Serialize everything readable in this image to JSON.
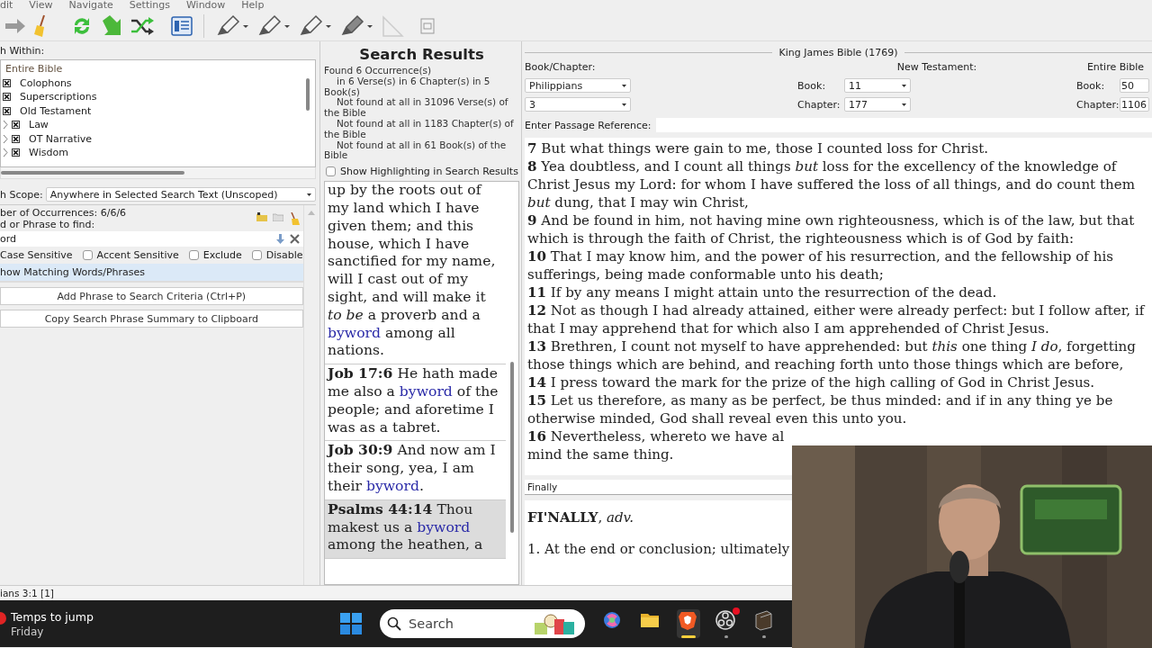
{
  "menu_bar": {
    "items": [
      "dit",
      "View",
      "Navigate",
      "Settings",
      "Window",
      "Help"
    ]
  },
  "search_within": {
    "label": "h Within:",
    "tree": [
      {
        "label": "Entire Bible",
        "children": [
          {
            "label": "Colophons",
            "checked": true
          },
          {
            "label": "Superscriptions",
            "checked": true
          },
          {
            "label": "Old Testament",
            "checked": true,
            "children": [
              {
                "label": "Law",
                "checked": true,
                "expanded": false
              },
              {
                "label": "OT Narrative",
                "checked": true,
                "expanded": false
              },
              {
                "label": "Wisdom",
                "checked": true,
                "expanded": false
              }
            ]
          }
        ]
      }
    ]
  },
  "scope": {
    "label": "h Scope:",
    "value": "Anywhere in Selected Search Text (Unscoped)"
  },
  "phrase": {
    "occurrences": "ber of Occurrences: 6/6/6",
    "prompt": "d or Phrase to find:",
    "value": "ord",
    "options": [
      {
        "label": "Case Sensitive",
        "kind": "label"
      },
      {
        "label": "Accent Sensitive",
        "kind": "checkbox",
        "checked": false
      },
      {
        "label": "Exclude",
        "kind": "checkbox",
        "checked": false
      },
      {
        "label": "Disable",
        "kind": "checkbox",
        "checked": false
      }
    ],
    "matching": "how Matching Words/Phrases",
    "buttons": [
      "Add Phrase to Search Criteria (Ctrl+P)",
      "Copy Search Phrase Summary to Clipboard"
    ]
  },
  "search_results": {
    "title": "Search Results",
    "summary": [
      {
        "text": "Found 6 Occurrence(s)",
        "kind": "total"
      },
      {
        "text": "in 6 Verse(s) in 6 Chapter(s) in 5 Book(s)",
        "kind": "detail"
      },
      {
        "text": "Not found at all in 31096 Verse(s) of the Bible",
        "kind": "detail"
      },
      {
        "text": "Not found at all in 1183 Chapter(s) of the Bible",
        "kind": "detail"
      },
      {
        "text": "Not found at all in 61 Book(s) of the Bible",
        "kind": "detail"
      }
    ],
    "show_highlighting": {
      "label": "Show Highlighting in Search Results",
      "checked": false
    },
    "results": [
      {
        "selected": false,
        "segments": [
          {
            "text": "up by the roots out of my land which I have given them; and this house, which I have sanctified for my name, will I cast out of my sight, and will make it ",
            "kind": "text"
          },
          {
            "text": "to be",
            "kind": "italic"
          },
          {
            "text": " a proverb and a ",
            "kind": "text"
          },
          {
            "text": "byword",
            "kind": "match"
          },
          {
            "text": " among all nations.",
            "kind": "text"
          }
        ]
      },
      {
        "reference": "Job 17:6",
        "selected": false,
        "segments": [
          {
            "text": "He hath made me also a ",
            "kind": "text"
          },
          {
            "text": "byword",
            "kind": "match"
          },
          {
            "text": " of the people; and aforetime I was as a tabret.",
            "kind": "text"
          }
        ]
      },
      {
        "reference": "Job 30:9",
        "selected": false,
        "segments": [
          {
            "text": "And now am I their song, yea, I am their ",
            "kind": "text"
          },
          {
            "text": "byword",
            "kind": "match"
          },
          {
            "text": ".",
            "kind": "text"
          }
        ]
      },
      {
        "reference": "Psalms 44:14",
        "selected": true,
        "segments": [
          {
            "text": "Thou makest us a ",
            "kind": "text"
          },
          {
            "text": "byword",
            "kind": "match"
          },
          {
            "text": " among the heathen, a",
            "kind": "text"
          }
        ]
      }
    ]
  },
  "bible": {
    "title": "King James Bible (1769)",
    "book_chapter": {
      "label": "Book/Chapter:",
      "book": "Philippians",
      "chapter": "3"
    },
    "new_testament": {
      "label": "New Testament:",
      "book_label": "Book:",
      "book": "11",
      "chapter_label": "Chapter:",
      "chapter": "177"
    },
    "entire_bible": {
      "label": "Entire Bible",
      "book_label": "Book:",
      "book": "50",
      "chapter_label": "Chapter:",
      "chapter": "1106"
    },
    "passage": {
      "label": "Enter Passage Reference:"
    },
    "lines": [
      "**7** But what things were gain to me, those I counted loss for Christ.",
      "**8** Yea doubtless, and I count all things *but* loss for the excellency of the knowledge of",
      "Christ Jesus my Lord: for whom I have suffered the loss of all things, and do count them",
      "*but* dung, that I may win Christ,",
      "**9** And be found in him, not having mine own righteousness, which is of the law, but that",
      "which is through the faith of Christ, the righteousness which is of God by faith:",
      "**10** That I may know him, and the power of his resurrection, and the fellowship of his",
      "sufferings, being made conformable unto his death;",
      "**11** If by any means I might attain unto the resurrection of the dead.",
      "**12** Not as though I had already attained, either were already perfect: but I follow after, if",
      "that I may apprehend that for which also I am apprehended of Christ Jesus.",
      "**13** Brethren, I count not myself to have apprehended: but *this* one thing *I do*, forgetting",
      "those things which are behind, and reaching forth unto those things which are before,",
      "**14** I press toward the mark for the prize of the high calling of God in Christ Jesus.",
      "**15** Let us therefore, as many as be perfect, be thus minded: and if in any thing ye be",
      "otherwise minded, God shall reveal even this unto you.",
      "**16** Nevertheless, whereto we have al",
      "mind the same thing."
    ]
  },
  "dictionary": {
    "word": "Finally",
    "headword": "**FI'NALLY**, *adv.*",
    "definition": "1. At the end or conclusion; ultimately"
  },
  "status_bar": {
    "text": "ians 3:1 [1]"
  },
  "taskbar": {
    "weather": {
      "title": "Temps to jump",
      "subtitle": "Friday"
    },
    "search": {
      "placeholder": "Search"
    },
    "apps": [
      {
        "kind": "swirl",
        "active": false,
        "running": false
      },
      {
        "kind": "folder",
        "active": false,
        "running": false
      },
      {
        "kind": "shield",
        "active": true,
        "running": true
      },
      {
        "kind": "ring",
        "active": false,
        "running": true,
        "notification": true
      },
      {
        "kind": "book",
        "active": false,
        "running": true
      }
    ]
  }
}
